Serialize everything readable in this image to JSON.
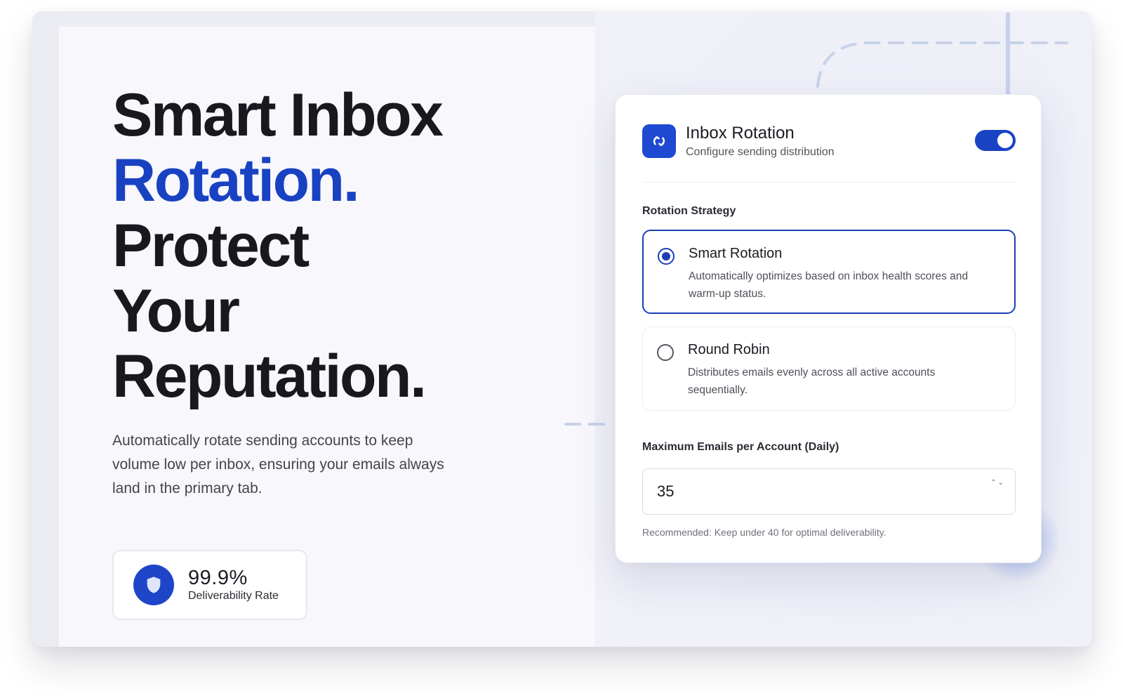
{
  "hero": {
    "headline": [
      "Smart Inbox",
      "Rotation.",
      "Protect",
      "Your",
      "Reputation."
    ],
    "description": "Automatically rotate sending accounts to keep volume low per inbox, ensuring your emails always land in the primary tab."
  },
  "stat": {
    "value": "99.9%",
    "label": "Deliverability Rate",
    "icon": "shield-icon"
  },
  "settings": {
    "title": "Inbox Rotation",
    "subtitle": "Configure sending distribution",
    "icon": "rotate-icon",
    "enabled": true,
    "strategy_label": "Rotation Strategy",
    "options": [
      {
        "title": "Smart Rotation",
        "description": "Automatically optimizes based on inbox health scores and warm-up status.",
        "selected": true
      },
      {
        "title": "Round Robin",
        "description": "Distributes emails evenly across all active accounts sequentially.",
        "selected": false
      }
    ],
    "max_label": "Maximum Emails per Account (Daily)",
    "max_value": "35",
    "hint": "Recommended: Keep under 40 for optimal deliverability."
  },
  "colors": {
    "accent": "#1842c2",
    "toggle_on": "#1a43c3",
    "icon_bg": "#1e49d0"
  }
}
